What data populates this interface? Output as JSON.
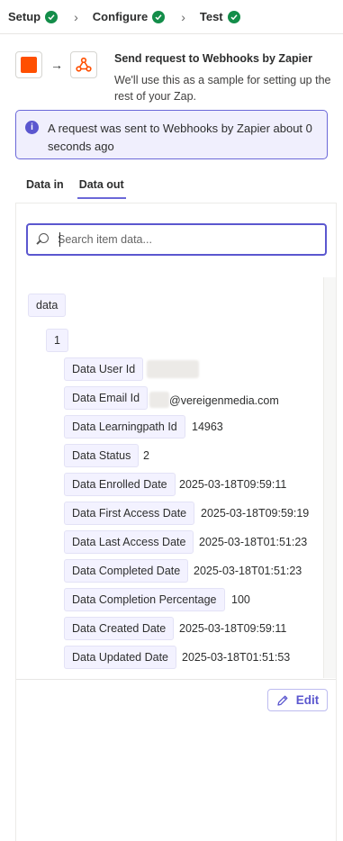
{
  "stepper": {
    "steps": [
      {
        "label": "Setup"
      },
      {
        "label": "Configure"
      },
      {
        "label": "Test"
      }
    ],
    "separator": "›"
  },
  "header": {
    "arrow": "→",
    "title": "Send request to Webhooks by Zapier",
    "subtitle": "We'll use this as a sample for setting up the rest of your Zap."
  },
  "banner": {
    "icon": "i",
    "text": "A request was sent to Webhooks by Zapier about 0 seconds ago"
  },
  "tabs": [
    {
      "label": "Data in"
    },
    {
      "label": "Data out"
    }
  ],
  "search": {
    "placeholder": "Search item data..."
  },
  "tree": {
    "root": "data",
    "index": "1",
    "fields": [
      {
        "key": "Data User Id",
        "value": ""
      },
      {
        "key": "Data Email Id",
        "value": "@vereigenmedia.com"
      },
      {
        "key": "Data Learningpath Id",
        "value": "14963"
      },
      {
        "key": "Data Status",
        "value": "2"
      },
      {
        "key": "Data Enrolled Date",
        "value": "2025-03-18T09:59:11"
      },
      {
        "key": "Data First Access Date",
        "value": "2025-03-18T09:59:19"
      },
      {
        "key": "Data Last Access Date",
        "value": "2025-03-18T01:51:23"
      },
      {
        "key": "Data Completed Date",
        "value": "2025-03-18T01:51:23"
      },
      {
        "key": "Data Completion Percentage",
        "value": "100"
      },
      {
        "key": "Data Created Date",
        "value": "2025-03-18T09:59:11"
      },
      {
        "key": "Data Updated Date",
        "value": "2025-03-18T01:51:53"
      }
    ]
  },
  "actions": {
    "edit_label": "Edit"
  },
  "colors": {
    "accent": "#5b57cf",
    "success": "#138d49",
    "brand_orange": "#ff4f00"
  }
}
